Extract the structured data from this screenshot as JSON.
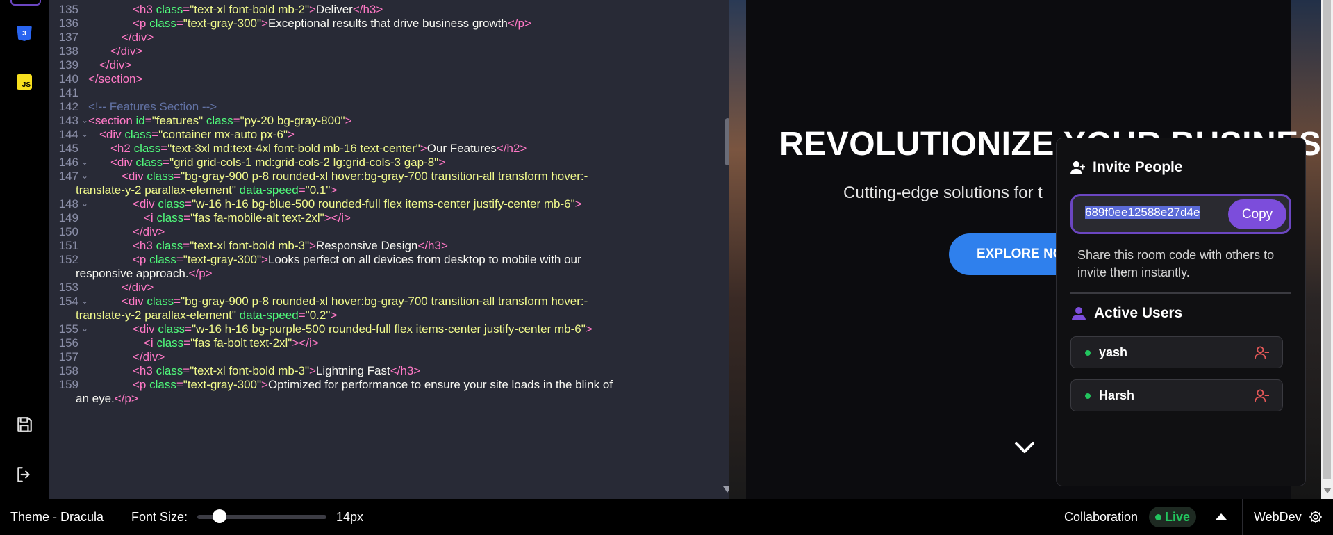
{
  "activity_bar": {
    "css_icon_label": "3",
    "js_icon_label": "JS"
  },
  "editor": {
    "lines": [
      {
        "n": "135",
        "fold": false,
        "segs": [
          [
            "t",
            "<h3 "
          ],
          [
            "a",
            "class"
          ],
          [
            "t",
            "="
          ],
          [
            "s",
            "\"text-xl font-bold mb-2\""
          ],
          [
            "t",
            ">"
          ],
          [
            "p",
            "Deliver"
          ],
          [
            "t",
            "</h3>"
          ]
        ],
        "indent": 160
      },
      {
        "n": "136",
        "fold": false,
        "segs": [
          [
            "t",
            "<p "
          ],
          [
            "a",
            "class"
          ],
          [
            "t",
            "="
          ],
          [
            "s",
            "\"text-gray-300\""
          ],
          [
            "t",
            ">"
          ],
          [
            "p",
            "Exceptional results that drive business growth"
          ],
          [
            "t",
            "</p>"
          ]
        ],
        "indent": 160
      },
      {
        "n": "137",
        "fold": false,
        "segs": [
          [
            "t",
            "</div>"
          ]
        ],
        "indent": 144
      },
      {
        "n": "138",
        "fold": false,
        "segs": [
          [
            "t",
            "</div>"
          ]
        ],
        "indent": 128
      },
      {
        "n": "139",
        "fold": false,
        "segs": [
          [
            "t",
            "</div>"
          ]
        ],
        "indent": 112
      },
      {
        "n": "140",
        "fold": false,
        "segs": [
          [
            "t",
            "</section>"
          ]
        ],
        "indent": 96
      },
      {
        "n": "141",
        "fold": false,
        "segs": [],
        "indent": 96
      },
      {
        "n": "142",
        "fold": false,
        "segs": [
          [
            "c",
            "<!-- Features Section -->"
          ]
        ],
        "indent": 96
      },
      {
        "n": "143",
        "fold": true,
        "segs": [
          [
            "t",
            "<section "
          ],
          [
            "a",
            "id"
          ],
          [
            "t",
            "="
          ],
          [
            "s",
            "\"features\" "
          ],
          [
            "a",
            "class"
          ],
          [
            "t",
            "="
          ],
          [
            "s",
            "\"py-20 bg-gray-800\""
          ],
          [
            "t",
            ">"
          ]
        ],
        "indent": 96
      },
      {
        "n": "144",
        "fold": true,
        "segs": [
          [
            "t",
            "<div "
          ],
          [
            "a",
            "class"
          ],
          [
            "t",
            "="
          ],
          [
            "s",
            "\"container mx-auto px-6\""
          ],
          [
            "t",
            ">"
          ]
        ],
        "indent": 112
      },
      {
        "n": "145",
        "fold": false,
        "segs": [
          [
            "t",
            "<h2 "
          ],
          [
            "a",
            "class"
          ],
          [
            "t",
            "="
          ],
          [
            "s",
            "\"text-3xl md:text-4xl font-bold mb-16 text-center\""
          ],
          [
            "t",
            ">"
          ],
          [
            "p",
            "Our Features"
          ],
          [
            "t",
            "</h2>"
          ]
        ],
        "indent": 128
      },
      {
        "n": "146",
        "fold": true,
        "segs": [
          [
            "t",
            "<div "
          ],
          [
            "a",
            "class"
          ],
          [
            "t",
            "="
          ],
          [
            "s",
            "\"grid grid-cols-1 md:grid-cols-2 lg:grid-cols-3 gap-8\""
          ],
          [
            "t",
            ">"
          ]
        ],
        "indent": 128
      },
      {
        "n": "147",
        "fold": true,
        "segs": [
          [
            "t",
            "<div "
          ],
          [
            "a",
            "class"
          ],
          [
            "t",
            "="
          ],
          [
            "s",
            "\"bg-gray-900 p-8 rounded-xl hover:bg-gray-700 transition-all transform hover:-"
          ]
        ],
        "indent": 144
      },
      {
        "n": "",
        "fold": false,
        "segs": [
          [
            "s",
            "translate-y-2 parallax-element\" "
          ],
          [
            "a",
            "data-speed"
          ],
          [
            "t",
            "="
          ],
          [
            "s",
            "\"0.1\""
          ],
          [
            "t",
            ">"
          ]
        ],
        "indent": 78
      },
      {
        "n": "148",
        "fold": true,
        "segs": [
          [
            "t",
            "<div "
          ],
          [
            "a",
            "class"
          ],
          [
            "t",
            "="
          ],
          [
            "s",
            "\"w-16 h-16 bg-blue-500 rounded-full flex items-center justify-center mb-6\""
          ],
          [
            "t",
            ">"
          ]
        ],
        "indent": 160
      },
      {
        "n": "149",
        "fold": false,
        "segs": [
          [
            "t",
            "<i "
          ],
          [
            "a",
            "class"
          ],
          [
            "t",
            "="
          ],
          [
            "s",
            "\"fas fa-mobile-alt text-2xl\""
          ],
          [
            "t",
            "></i>"
          ]
        ],
        "indent": 176
      },
      {
        "n": "150",
        "fold": false,
        "segs": [
          [
            "t",
            "</div>"
          ]
        ],
        "indent": 160
      },
      {
        "n": "151",
        "fold": false,
        "segs": [
          [
            "t",
            "<h3 "
          ],
          [
            "a",
            "class"
          ],
          [
            "t",
            "="
          ],
          [
            "s",
            "\"text-xl font-bold mb-3\""
          ],
          [
            "t",
            ">"
          ],
          [
            "p",
            "Responsive Design"
          ],
          [
            "t",
            "</h3>"
          ]
        ],
        "indent": 160
      },
      {
        "n": "152",
        "fold": false,
        "segs": [
          [
            "t",
            "<p "
          ],
          [
            "a",
            "class"
          ],
          [
            "t",
            "="
          ],
          [
            "s",
            "\"text-gray-300\""
          ],
          [
            "t",
            ">"
          ],
          [
            "p",
            "Looks perfect on all devices from desktop to mobile with our"
          ]
        ],
        "indent": 160
      },
      {
        "n": "",
        "fold": false,
        "segs": [
          [
            "p",
            "responsive approach."
          ],
          [
            "t",
            "</p>"
          ]
        ],
        "indent": 78
      },
      {
        "n": "153",
        "fold": false,
        "segs": [
          [
            "t",
            "</div>"
          ]
        ],
        "indent": 144
      },
      {
        "n": "154",
        "fold": true,
        "segs": [
          [
            "t",
            "<div "
          ],
          [
            "a",
            "class"
          ],
          [
            "t",
            "="
          ],
          [
            "s",
            "\"bg-gray-900 p-8 rounded-xl hover:bg-gray-700 transition-all transform hover:-"
          ]
        ],
        "indent": 144
      },
      {
        "n": "",
        "fold": false,
        "segs": [
          [
            "s",
            "translate-y-2 parallax-element\" "
          ],
          [
            "a",
            "data-speed"
          ],
          [
            "t",
            "="
          ],
          [
            "s",
            "\"0.2\""
          ],
          [
            "t",
            ">"
          ]
        ],
        "indent": 78
      },
      {
        "n": "155",
        "fold": true,
        "segs": [
          [
            "t",
            "<div "
          ],
          [
            "a",
            "class"
          ],
          [
            "t",
            "="
          ],
          [
            "s",
            "\"w-16 h-16 bg-purple-500 rounded-full flex items-center justify-center mb-6\""
          ],
          [
            "t",
            ">"
          ]
        ],
        "indent": 160
      },
      {
        "n": "156",
        "fold": false,
        "segs": [
          [
            "t",
            "<i "
          ],
          [
            "a",
            "class"
          ],
          [
            "t",
            "="
          ],
          [
            "s",
            "\"fas fa-bolt text-2xl\""
          ],
          [
            "t",
            "></i>"
          ]
        ],
        "indent": 176
      },
      {
        "n": "157",
        "fold": false,
        "segs": [
          [
            "t",
            "</div>"
          ]
        ],
        "indent": 160
      },
      {
        "n": "158",
        "fold": false,
        "segs": [
          [
            "t",
            "<h3 "
          ],
          [
            "a",
            "class"
          ],
          [
            "t",
            "="
          ],
          [
            "s",
            "\"text-xl font-bold mb-3\""
          ],
          [
            "t",
            ">"
          ],
          [
            "p",
            "Lightning Fast"
          ],
          [
            "t",
            "</h3>"
          ]
        ],
        "indent": 160
      },
      {
        "n": "159",
        "fold": false,
        "segs": [
          [
            "t",
            "<p "
          ],
          [
            "a",
            "class"
          ],
          [
            "t",
            "="
          ],
          [
            "s",
            "\"text-gray-300\""
          ],
          [
            "t",
            ">"
          ],
          [
            "p",
            "Optimized for performance to ensure your site loads in the blink of"
          ]
        ],
        "indent": 160
      },
      {
        "n": "",
        "fold": false,
        "segs": [
          [
            "p",
            "an eye."
          ],
          [
            "t",
            "</p>"
          ]
        ],
        "indent": 78
      }
    ]
  },
  "preview": {
    "hero_title": "REVOLUTIONIZE YOUR BUSINESS",
    "hero_subtitle": "Cutting-edge solutions for t",
    "hero_button": "EXPLORE NO"
  },
  "invite_panel": {
    "title": "Invite People",
    "room_code": "689f0ee12588e27d4e",
    "copy_label": "Copy",
    "help_text": "Share this room code with others to invite them instantly.",
    "active_users_title": "Active Users",
    "users": [
      "yash",
      "Harsh"
    ]
  },
  "status_bar": {
    "theme": "Theme - Dracula",
    "font_size_label": "Font Size:",
    "font_size_value": "14px",
    "font_size_slider_fraction": 0.17,
    "collaboration_label": "Collaboration",
    "live_label": "Live",
    "app_name": "WebDev"
  },
  "colors": {
    "editor_bg": "#282a36",
    "tag": "#ff79c6",
    "attr": "#50fa7b",
    "string": "#f1fa8c",
    "comment": "#6272a4",
    "accent_purple": "#7c4ddb",
    "live_green": "#22c55e",
    "hero_button": "#2f80ed"
  },
  "icons": {
    "save": "save-icon",
    "exit": "logout-icon",
    "invite": "user-plus-icon",
    "active_users": "user-icon",
    "remove_user": "user-minus-icon",
    "scroll_down": "chevron-down-icon",
    "collab_toggle": "chevron-up-icon",
    "settings": "gear-icon"
  }
}
